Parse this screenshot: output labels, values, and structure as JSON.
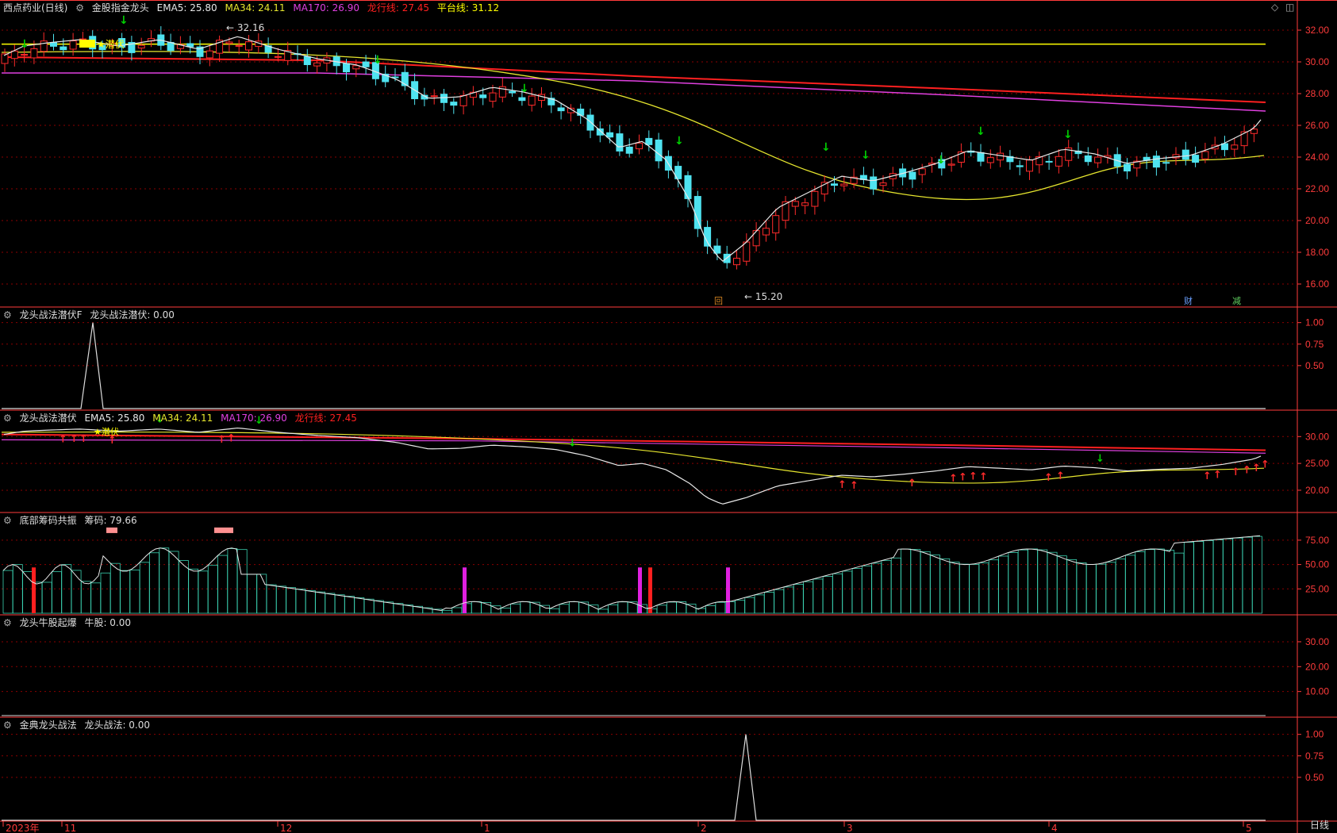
{
  "colors": {
    "bg": "#000000",
    "grid": "#8b0000",
    "axis": "#ff3b3b",
    "up": "#ff2b2b",
    "down": "#4fe3f0",
    "ema5": "#e8e8e8",
    "ma34": "#e6e62e",
    "ma170": "#e040e0",
    "dragon": "#ff2020",
    "platform": "#ffff00",
    "signal_down": "#00d000"
  },
  "header": {
    "stock": "西点药业(日线)",
    "main_title": "金股指金龙头",
    "ema5": "EMA5: 25.80",
    "ma34": "MA34: 24.11",
    "ma170": "MA170: 26.90",
    "dragon": "龙行线: 27.45",
    "platform": "平台线: 31.12"
  },
  "main_panel": {
    "y_ticks": [
      "32.00",
      "30.00",
      "28.00",
      "26.00",
      "24.00",
      "22.00",
      "20.00",
      "18.00",
      "16.00"
    ],
    "high_label": "32.16",
    "low_label": "15.20",
    "tag_text": "潜伏",
    "markers": {
      "back": "回",
      "fin": "财",
      "reduce": "减"
    }
  },
  "panel2": {
    "title": "龙头战法潜伏F",
    "value": "龙头战法潜伏: 0.00",
    "y_ticks": [
      "1.00",
      "0.75",
      "0.50"
    ]
  },
  "panel3": {
    "title": "龙头战法潜伏",
    "ema5": "EMA5: 25.80",
    "ma34": "MA34: 24.11",
    "ma170": "MA170: 26.90",
    "dragon": "龙行线: 27.45",
    "y_ticks": [
      "30.00",
      "25.00",
      "20.00"
    ],
    "tag_text": "潜伏"
  },
  "panel4": {
    "title": "底部筹码共振",
    "value": "筹码: 79.66",
    "y_ticks": [
      "75.00",
      "50.00",
      "25.00"
    ]
  },
  "panel5": {
    "title": "龙头牛股起爆",
    "value": "牛股: 0.00",
    "y_ticks": [
      "30.00",
      "20.00",
      "10.00"
    ]
  },
  "panel6": {
    "title": "金典龙头战法",
    "value": "龙头战法: 0.00",
    "y_ticks": [
      "1.00",
      "0.75",
      "0.50"
    ]
  },
  "x_axis": {
    "labels": [
      "2023年",
      "11",
      "12",
      "1",
      "2",
      "3",
      "4",
      "5"
    ],
    "period": "日线"
  },
  "icons": [
    "diamond-icon",
    "window-icon"
  ]
}
